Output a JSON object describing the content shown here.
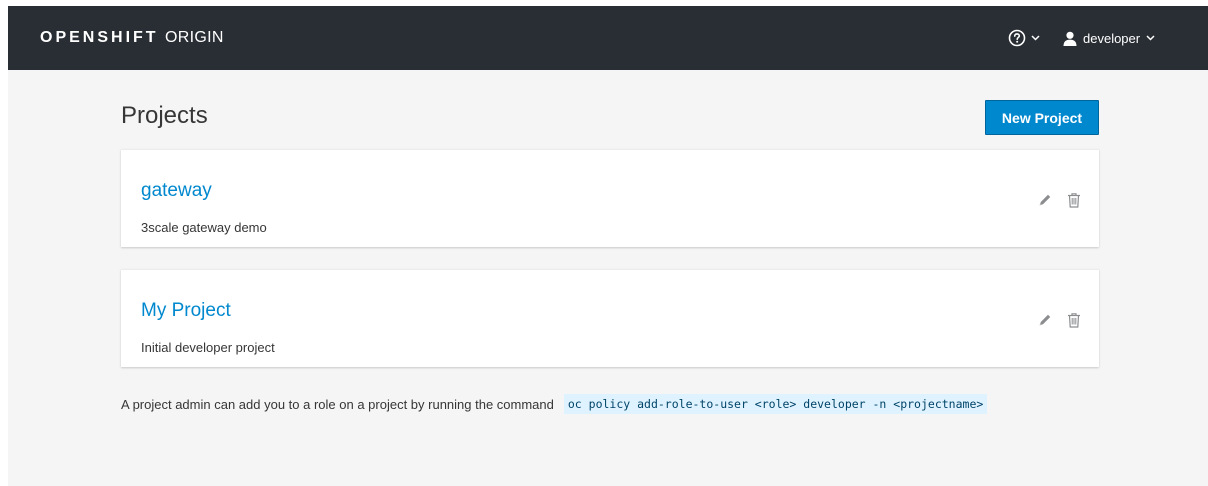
{
  "header": {
    "brand_bold": "OPENSHIFT",
    "brand_light": "ORIGIN",
    "help_icon": "help-circle-icon",
    "user_icon": "user-icon",
    "user_name": "developer"
  },
  "main": {
    "title": "Projects",
    "new_project_label": "New Project",
    "projects": [
      {
        "name": "gateway",
        "description": "3scale gateway demo"
      },
      {
        "name": "My Project",
        "description": "Initial developer project"
      }
    ],
    "note_text": "A project admin can add you to a role on a project by running the command",
    "note_command": "oc policy add-role-to-user <role> developer -n <projectname>"
  },
  "colors": {
    "topbar": "#292e34",
    "background": "#f5f5f5",
    "accent": "#0088ce",
    "command_bg": "#def3ff"
  }
}
